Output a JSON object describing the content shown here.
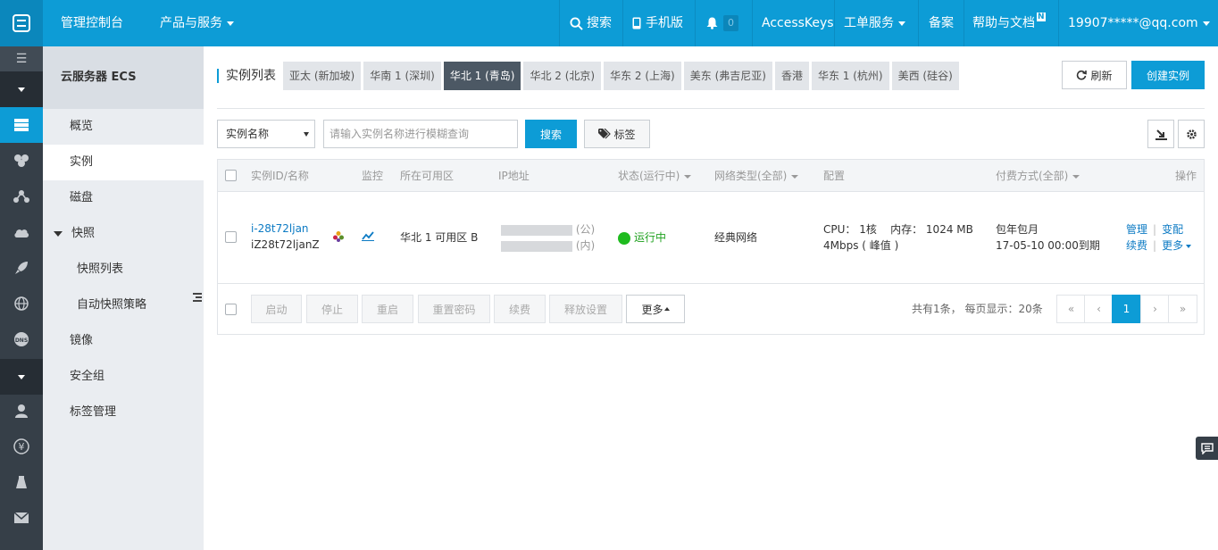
{
  "topbar": {
    "console": "管理控制台",
    "products": "产品与服务",
    "search": "搜索",
    "mobile": "手机版",
    "notify_count": "0",
    "accesskeys": "AccessKeys",
    "tickets": "工单服务",
    "icp": "备案",
    "help": "帮助与文档",
    "help_badge": "N",
    "account": "19907*****@qq.com"
  },
  "rail": {
    "icons": [
      "menu-icon",
      "collapse-arrow-icon",
      "server-icon",
      "cluster-icon",
      "network-icon",
      "cloud-icon",
      "rocket-icon",
      "globe-icon",
      "dns-icon",
      "collapse-arrow-icon",
      "user-icon",
      "yen-icon",
      "tools-icon",
      "mail-icon"
    ]
  },
  "sidebar": {
    "title": "云服务器 ECS",
    "items": [
      {
        "label": "概览"
      },
      {
        "label": "实例"
      },
      {
        "label": "磁盘"
      },
      {
        "label": "快照"
      },
      {
        "label": "快照列表"
      },
      {
        "label": "自动快照策略"
      },
      {
        "label": "镜像"
      },
      {
        "label": "安全组"
      },
      {
        "label": "标签管理"
      }
    ]
  },
  "main": {
    "region_label": "实例列表",
    "regions": [
      "亚太 (新加坡)",
      "华南 1 (深圳)",
      "华北 1 (青岛)",
      "华北 2 (北京)",
      "华东 2 (上海)",
      "美东 (弗吉尼亚)",
      "香港",
      "华东 1 (杭州)",
      "美西 (硅谷)"
    ],
    "active_region": "华北 1 (青岛)",
    "refresh": "刷新",
    "create": "创建实例",
    "filter_select": "实例名称",
    "search_placeholder": "请输入实例名称进行模糊查询",
    "search_btn": "搜索",
    "tag_btn": "标签"
  },
  "table": {
    "headers": {
      "id": "实例ID/名称",
      "monitor": "监控",
      "zone": "所在可用区",
      "ip": "IP地址",
      "status": "状态(运行中)",
      "net": "网络类型(全部)",
      "config": "配置",
      "billing": "付费方式(全部)",
      "actions": "操作"
    },
    "rows": [
      {
        "id": "i-28t72ljan",
        "name": "iZ28t72ljanZ",
        "zone": "华北 1 可用区 B",
        "ip_public_suffix": "(公)",
        "ip_private_suffix": "(内)",
        "status": "运行中",
        "net": "经典网络",
        "config_line1": "CPU： 1核    内存： 1024 MB",
        "config_line2": "4Mbps ( 峰值 )",
        "billing_line1": "包年包月",
        "billing_line2": "17-05-10 00:00到期",
        "actions": {
          "manage": "管理",
          "upgrade": "变配",
          "renew": "续费",
          "more": "更多"
        }
      }
    ]
  },
  "footer": {
    "buttons": [
      "启动",
      "停止",
      "重启",
      "重置密码",
      "续费",
      "释放设置"
    ],
    "more": "更多",
    "page_info": "共有1条， 每页显示：20条",
    "pagination": {
      "first": "«",
      "prev": "‹",
      "current": "1",
      "next": "›",
      "last": "»"
    }
  },
  "colors": {
    "accent": "#0d9cd6",
    "rail": "#363f48",
    "running": "#1fbb1f"
  }
}
